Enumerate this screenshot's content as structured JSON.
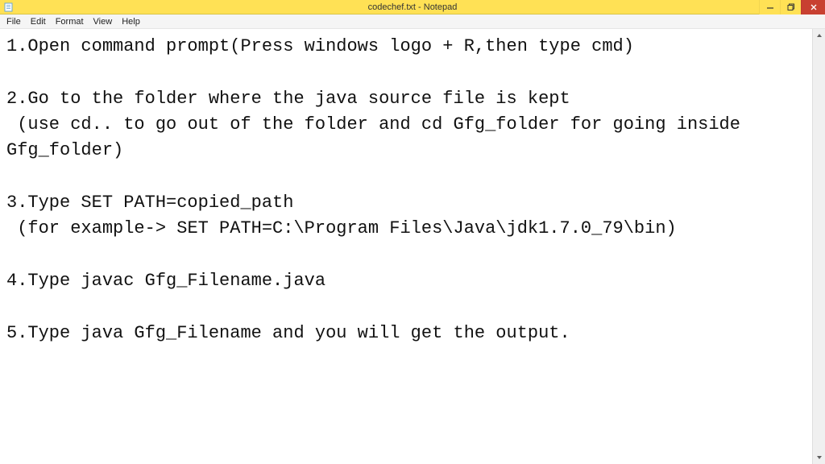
{
  "window": {
    "title": "codechef.txt - Notepad"
  },
  "menu": {
    "file": "File",
    "edit": "Edit",
    "format": "Format",
    "view": "View",
    "help": "Help"
  },
  "editor": {
    "text": "1.Open command prompt(Press windows logo + R,then type cmd)\n\n2.Go to the folder where the java source file is kept\n (use cd.. to go out of the folder and cd Gfg_folder for going inside Gfg_folder)\n\n3.Type SET PATH=copied_path\n (for example-> SET PATH=C:\\Program Files\\Java\\jdk1.7.0_79\\bin)\n\n4.Type javac Gfg_Filename.java\n\n5.Type java Gfg_Filename and you will get the output."
  },
  "controls": {
    "minimize": "—",
    "maximize": "❐",
    "close": "✕"
  }
}
